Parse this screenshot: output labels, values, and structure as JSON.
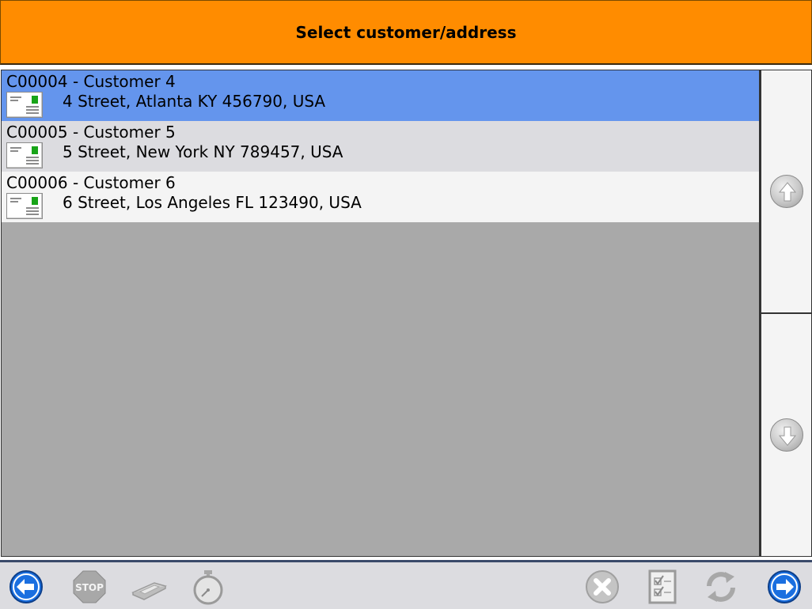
{
  "header": {
    "title": "Select customer/address"
  },
  "list": {
    "items": [
      {
        "title": "C00004 - Customer 4",
        "address": "4 Street, Atlanta KY  456790, USA",
        "selected": true
      },
      {
        "title": "C00005 - Customer 5",
        "address": "5 Street, New York NY  789457, USA",
        "selected": false
      },
      {
        "title": "C00006 - Customer 6",
        "address": "6 Street, Los Angeles FL  123490, USA",
        "selected": false
      }
    ]
  },
  "scroll": {
    "up_icon": "arrow-up-circle-icon",
    "down_icon": "arrow-down-circle-icon"
  },
  "toolbar": {
    "stop_label": "STOP",
    "icons": [
      "back-arrow-icon",
      "stop-sign-icon",
      "scanner-icon",
      "stopwatch-icon",
      "cancel-x-icon",
      "checklist-icon",
      "refresh-icon",
      "forward-arrow-icon"
    ]
  },
  "colors": {
    "header_bg": "#ff8c00",
    "selected_row": "#6495ed",
    "alt_row": "#dcdce0",
    "empty_area": "#a9a9a9",
    "nav_blue": "#1a6fe0"
  }
}
